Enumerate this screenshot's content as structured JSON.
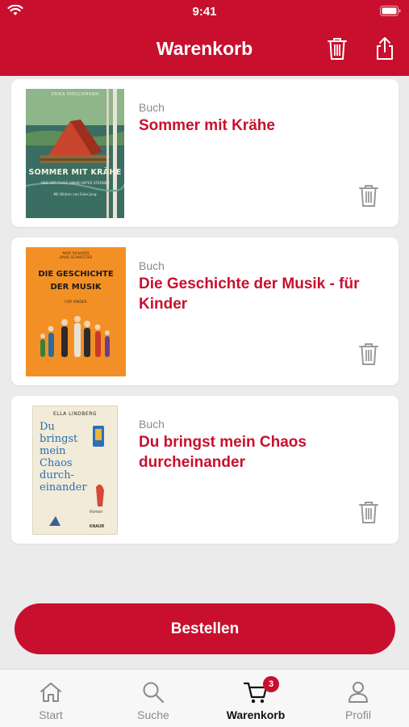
{
  "status_bar": {
    "time": "9:41"
  },
  "header": {
    "title": "Warenkorb"
  },
  "cart": {
    "items": [
      {
        "type": "Buch",
        "title": "Sommer mit Krähe",
        "cover": {
          "author": "ERIKA HIRSCHMANN",
          "title": "SOMMER MIT KRÄHE",
          "subtitle": "UND DER FLUSS HINAB UNTER STERNEN",
          "illustrator": "Mit Bildern von Eske Jung"
        }
      },
      {
        "type": "Buch",
        "title": "Die Geschichte der Musik - für Kinder",
        "cover": {
          "authors": "MARY RICHARDS\nDAVID SCHWEITZER",
          "title_line1": "DIE GESCHICHTE",
          "title_line2": "DER MUSIK",
          "subtitle": "FÜR KINDER"
        }
      },
      {
        "type": "Buch",
        "title": "Du bringst mein Chaos durcheinander",
        "cover": {
          "author": "ELLA LINDBERG",
          "line1": "Du",
          "line2": "bringst",
          "line3": "mein",
          "line4": "Chaos",
          "line5": "durch-",
          "line6": "einander",
          "genre": "Roman",
          "publisher": "KNAUR"
        }
      }
    ]
  },
  "order_button": {
    "label": "Bestellen"
  },
  "tabbar": {
    "tabs": [
      {
        "label": "Start",
        "icon": "home-icon"
      },
      {
        "label": "Suche",
        "icon": "search-icon"
      },
      {
        "label": "Warenkorb",
        "icon": "cart-icon",
        "badge": "3"
      },
      {
        "label": "Profil",
        "icon": "profile-icon"
      }
    ]
  },
  "colors": {
    "brand": "#c8102e",
    "background": "#ebebeb"
  }
}
